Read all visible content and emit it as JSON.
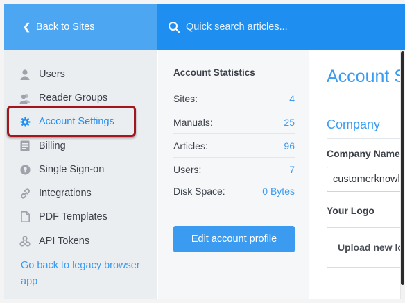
{
  "header": {
    "back_label": "Back to Sites",
    "search_placeholder": "Quick search articles..."
  },
  "sidebar": {
    "items": [
      {
        "label": "Users",
        "icon": "user-icon"
      },
      {
        "label": "Reader Groups",
        "icon": "group-icon"
      },
      {
        "label": "Account Settings",
        "icon": "gear-icon",
        "active": true
      },
      {
        "label": "Billing",
        "icon": "billing-icon"
      },
      {
        "label": "Single Sign-on",
        "icon": "key-icon"
      },
      {
        "label": "Integrations",
        "icon": "link-icon"
      },
      {
        "label": "PDF Templates",
        "icon": "document-icon"
      },
      {
        "label": "API Tokens",
        "icon": "api-icon"
      }
    ],
    "legacy_link": "Go back to legacy browser app"
  },
  "stats": {
    "title": "Account Statistics",
    "rows": [
      {
        "label": "Sites:",
        "value": "4"
      },
      {
        "label": "Manuals:",
        "value": "25"
      },
      {
        "label": "Articles:",
        "value": "96"
      },
      {
        "label": "Users:",
        "value": "7"
      },
      {
        "label": "Disk Space:",
        "value": "0 Bytes"
      }
    ],
    "edit_button": "Edit account profile"
  },
  "main": {
    "title": "Account S",
    "section": "Company",
    "company_name_label": "Company Name",
    "company_name_value": "customerknowl",
    "logo_label": "Your Logo",
    "upload_label": "Upload new lo"
  },
  "colors": {
    "accent": "#3a9bf0",
    "back_bar": "#4da6f2",
    "search_bar": "#1f8ef1",
    "highlight": "#a3161d",
    "sidebar_bg": "#ebeef1"
  }
}
